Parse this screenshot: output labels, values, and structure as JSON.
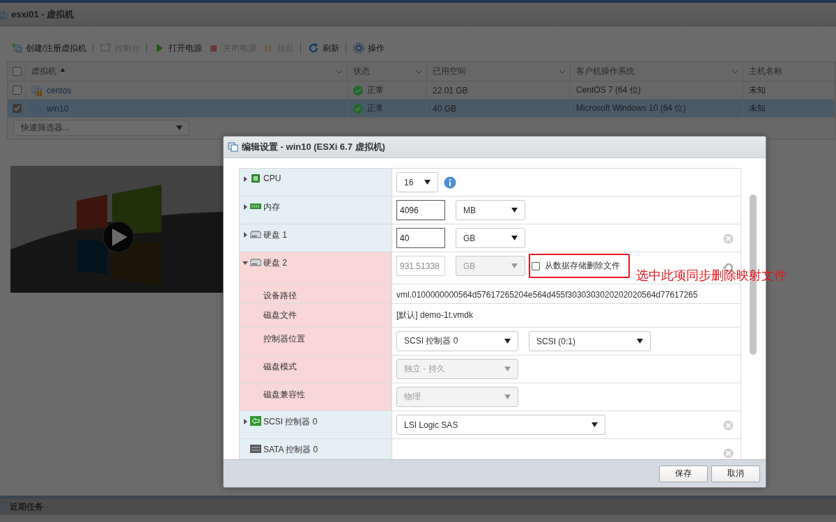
{
  "top_bar": {
    "title": "esxi01 - 虚拟机"
  },
  "toolbar_groups": [
    [
      {
        "kind": "create",
        "label": "创建/注册虚拟机",
        "disabled": false
      }
    ],
    [
      {
        "kind": "console",
        "label": "控制台",
        "disabled": true
      }
    ],
    [
      {
        "kind": "power-on",
        "label": "打开电源",
        "disabled": false
      },
      {
        "kind": "power-off",
        "label": "关闭电源",
        "disabled": true
      },
      {
        "kind": "suspend",
        "label": "挂起",
        "disabled": true
      }
    ],
    [
      {
        "kind": "refresh",
        "label": "刷新",
        "disabled": false
      }
    ],
    [
      {
        "kind": "actions",
        "label": "操作",
        "disabled": false
      }
    ]
  ],
  "vm_table": {
    "header_checked": false,
    "columns": [
      {
        "label": "虚拟机",
        "sort_mark": "▲"
      },
      {
        "label": "状态"
      },
      {
        "label": "已用空间"
      },
      {
        "label": "客户机操作系统"
      },
      {
        "label": "主机名称"
      }
    ],
    "rows": [
      {
        "selected": false,
        "checked": false,
        "kind": "suspended",
        "name": "centos",
        "status": "正常",
        "used": "22.01 GB",
        "os": "CentOS 7 (64 位)",
        "host": "未知"
      },
      {
        "selected": true,
        "checked": true,
        "kind": "off",
        "name": "win10",
        "status": "正常",
        "used": "40 GB",
        "os": "Microsoft Windows 10 (64 位)",
        "host": "未知"
      }
    ]
  },
  "quick_filter": {
    "value": "快速筛选器..."
  },
  "recent_tasks": {
    "title": "近期任务"
  },
  "dialog": {
    "title": "编辑设置 - win10 (ESXi 6.7 虚拟机)",
    "rows": [
      {
        "kind": "cpu",
        "label": "CPU",
        "expanded": false,
        "removed": false,
        "controls": [
          {
            "kind": "select",
            "value": "16",
            "disabled": false
          },
          {
            "kind": "info"
          }
        ]
      },
      {
        "kind": "memory",
        "label": "内存",
        "expanded": false,
        "removed": false,
        "controls": [
          {
            "kind": "input",
            "value": "4096",
            "disabled": false
          },
          {
            "kind": "select",
            "value": "MB",
            "disabled": false
          }
        ]
      },
      {
        "kind": "disk",
        "label": "硬盘 1",
        "expanded": false,
        "removed": false,
        "removable": true,
        "controls": [
          {
            "kind": "input",
            "value": "40",
            "disabled": false
          },
          {
            "kind": "select",
            "value": "GB",
            "disabled": false
          }
        ]
      },
      {
        "kind": "disk",
        "label": "硬盘 2",
        "expanded": true,
        "removed": true,
        "removable": true,
        "controls": [
          {
            "kind": "input",
            "value": "931.51338",
            "disabled": true
          },
          {
            "kind": "select",
            "value": "GB",
            "disabled": true
          },
          {
            "kind": "checkbox",
            "label": "从数据存储删除文件",
            "checked": false,
            "highlighted": true
          }
        ],
        "children": [
          {
            "label": "设备路径",
            "controls": [
              {
                "kind": "text",
                "value": "vml.0100000000564d57617265204e564d455f3030303020202020564d77617265"
              }
            ]
          },
          {
            "label": "磁盘文件",
            "controls": [
              {
                "kind": "text",
                "value": "[默认] demo-1t.vmdk"
              }
            ]
          },
          {
            "label": "控制器位置",
            "controls": [
              {
                "kind": "select",
                "value": "SCSI 控制器 0",
                "disabled": false
              },
              {
                "kind": "select",
                "value": "SCSI (0:1)",
                "disabled": false
              }
            ]
          },
          {
            "label": "磁盘模式",
            "controls": [
              {
                "kind": "select",
                "value": "独立 - 持久",
                "disabled": true
              }
            ]
          },
          {
            "label": "磁盘兼容性",
            "controls": [
              {
                "kind": "select",
                "value": "物理",
                "disabled": true
              }
            ]
          }
        ]
      },
      {
        "kind": "scsi",
        "label": "SCSI 控制器 0",
        "expanded": false,
        "removed": false,
        "removable": true,
        "controls": [
          {
            "kind": "select",
            "value": "LSI Logic SAS",
            "disabled": false
          }
        ]
      },
      {
        "kind": "sata",
        "label": "SATA 控制器 0",
        "removed": false,
        "removable": true,
        "controls": []
      }
    ],
    "buttons": [
      "保存",
      "取消"
    ]
  },
  "annotation": {
    "text": "选中此项同步删除映射文件"
  }
}
